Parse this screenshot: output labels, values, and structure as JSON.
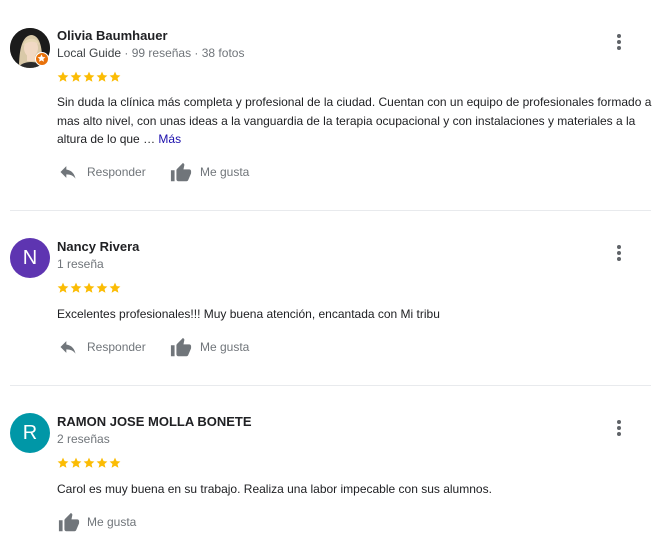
{
  "colors": {
    "star": "#fbbc04",
    "nancy_avatar": "#5e35b1",
    "ramon_avatar": "#0097a7",
    "more_link": "#1a0dab"
  },
  "reviews": [
    {
      "name": "Olivia Baumhauer",
      "guide_label": "Local Guide",
      "stats": " · 99 reseñas · 38 fotos",
      "avatar_icon": "profile-photo",
      "badge_icon": "local-guide-star-icon",
      "stars": 5,
      "text": "Sin duda la clínica más completa y profesional de la ciudad. Cuentan con un equipo de profesionales formado a mas alto nivel, con unas ideas a la vanguardia de la terapia ocupacional y con instalaciones y materiales a la altura de lo que … ",
      "more_label": "Más",
      "reply_label": "Responder",
      "like_label": "Me gusta"
    },
    {
      "name": "Nancy Rivera",
      "stats": "1 reseña",
      "avatar_letter": "N",
      "stars": 5,
      "text": "Excelentes profesionales!!! Muy buena atención, encantada con Mi tribu",
      "reply_label": "Responder",
      "like_label": "Me gusta"
    },
    {
      "name": "RAMON JOSE MOLLA BONETE",
      "stats": "2 reseñas",
      "avatar_letter": "R",
      "stars": 5,
      "text": "Carol es muy buena en su trabajo. Realiza una labor impecable con sus alumnos.",
      "like_label": "Me gusta"
    }
  ]
}
